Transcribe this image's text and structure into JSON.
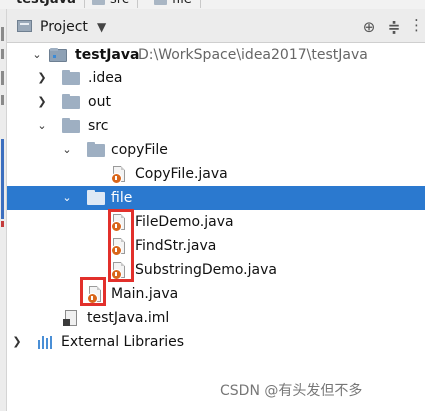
{
  "breadcrumbs": [
    {
      "label": "testJava"
    },
    {
      "label": "src"
    },
    {
      "label": "file"
    }
  ],
  "header": {
    "title": "Project",
    "dropdown_icon": "triangle-down",
    "buttons": [
      {
        "name": "locate",
        "icon": "crosshair-icon"
      },
      {
        "name": "collapse-all",
        "icon": "collapse-icon"
      },
      {
        "name": "more",
        "icon": "vertical-dots-icon"
      }
    ]
  },
  "tree": {
    "root": {
      "label": "testJava",
      "path": "D:\\WorkSpace\\idea2017\\testJava"
    },
    "idea": {
      "label": ".idea"
    },
    "out": {
      "label": "out"
    },
    "src": {
      "label": "src"
    },
    "copyFile": {
      "label": "copyFile"
    },
    "copyFileJava": {
      "label": "CopyFile.java"
    },
    "file": {
      "label": "file"
    },
    "fileDemo": {
      "label": "FileDemo.java"
    },
    "findStr": {
      "label": "FindStr.java"
    },
    "substringDemo": {
      "label": "SubstringDemo.java"
    },
    "mainJava": {
      "label": "Main.java"
    },
    "iml": {
      "label": "testJava.iml"
    },
    "externalLibraries": {
      "label": "External Libraries"
    }
  },
  "colors": {
    "selection": "#2b79cf",
    "highlight_box": "#e2302b",
    "folder": "#9eafc2"
  },
  "watermark": "CSDN @有头发但不多"
}
